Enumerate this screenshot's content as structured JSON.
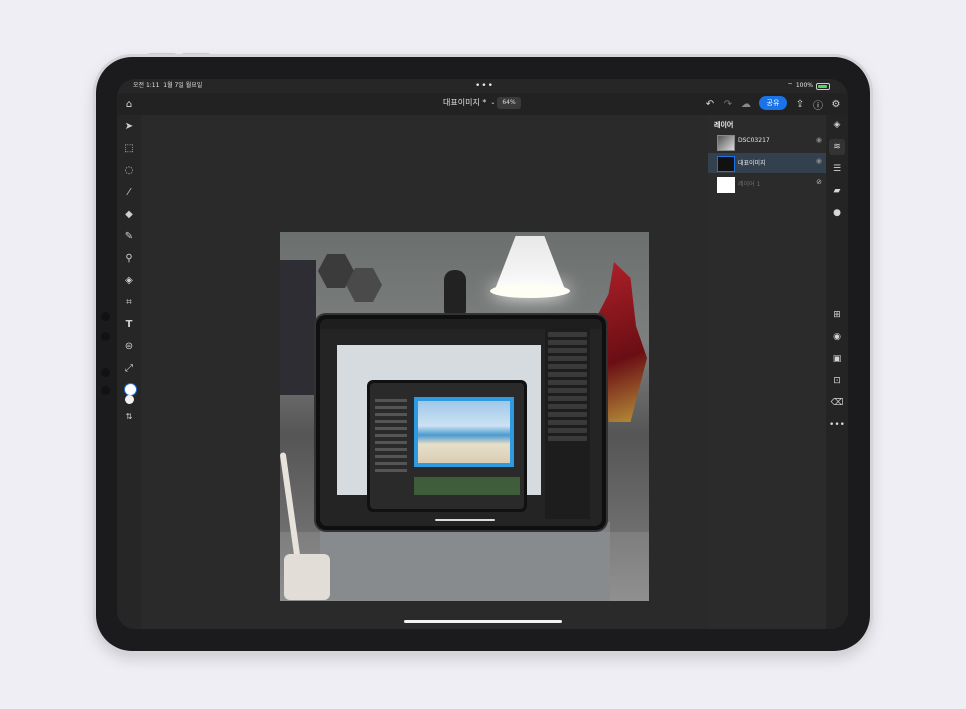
{
  "status_bar": {
    "time": "오전 1:11",
    "date": "1월 7일 월요일",
    "battery": "100%",
    "multitask_dots": "•••"
  },
  "topbar": {
    "document_name": "대표이미지 *",
    "zoom": "64%",
    "share_label": "공유"
  },
  "layers_panel": {
    "title": "레이어",
    "layers": [
      {
        "name": "DSC03217",
        "selected": false,
        "visible": true
      },
      {
        "name": "대표이미지",
        "selected": true,
        "visible": true
      },
      {
        "name": "레이어 1",
        "selected": false,
        "visible": false
      }
    ]
  },
  "colors": {
    "accent": "#1a73e8",
    "selected_row": "#33414f",
    "screen_bg": "#262626",
    "battery_green": "#4cd964"
  },
  "icons": {
    "left_toolbar": [
      "move-icon",
      "transform-icon",
      "lasso-icon",
      "brush-icon",
      "eraser-icon",
      "healing-icon",
      "clone-icon",
      "fill-icon",
      "crop-icon",
      "type-icon",
      "adjust-icon",
      "eyedropper-icon",
      "color-swatch",
      "swap-icon"
    ],
    "right_toolbar": [
      "layers-icon",
      "layer-properties-icon",
      "adjustments-icon",
      "comments-icon",
      "info-icon",
      "add-layer-icon",
      "visibility-icon",
      "mask-icon",
      "place-image-icon",
      "clear-icon",
      "more-icon"
    ]
  }
}
